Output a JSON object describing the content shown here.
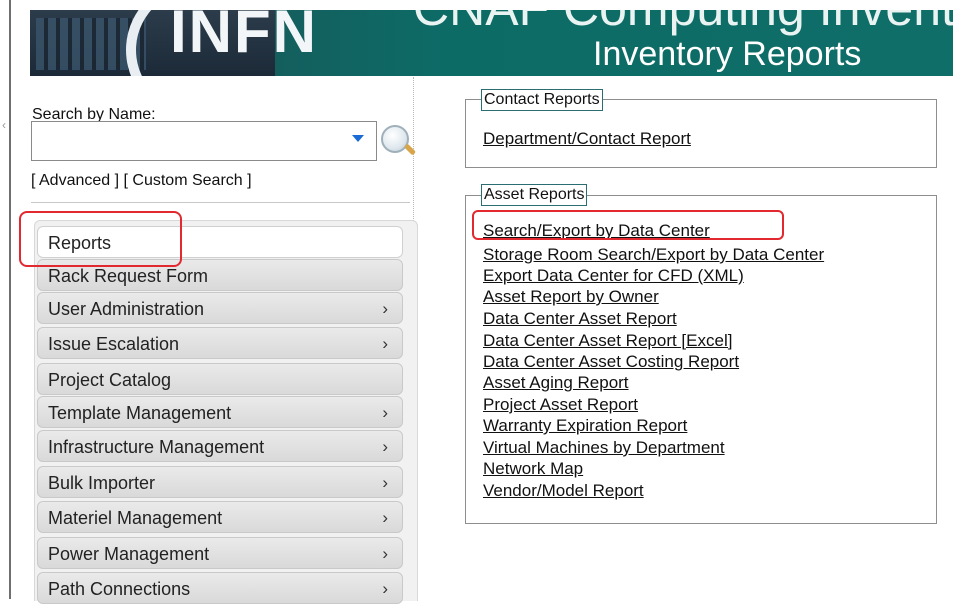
{
  "header": {
    "logo_text": "INFN",
    "title": "CNAF Computing Inventory",
    "subtitle": "Inventory Reports",
    "colors": {
      "banner": "#0f6e68",
      "logo_bg": "#1c2a38"
    }
  },
  "sidebar": {
    "search_label": "Search by Name:",
    "search_value": "",
    "advanced_link": "[ Advanced ]",
    "custom_search_link": "[ Custom Search ]",
    "menu": [
      {
        "label": "Reports",
        "submenu": false,
        "active": true
      },
      {
        "label": "Rack Request Form",
        "submenu": false
      },
      {
        "label": "User Administration",
        "submenu": true
      },
      {
        "label": "Issue Escalation",
        "submenu": true
      },
      {
        "label": "Project Catalog",
        "submenu": false
      },
      {
        "label": "Template Management",
        "submenu": true
      },
      {
        "label": "Infrastructure Management",
        "submenu": true
      },
      {
        "label": "Bulk Importer",
        "submenu": true
      },
      {
        "label": "Materiel Management",
        "submenu": true
      },
      {
        "label": "Power Management",
        "submenu": true
      },
      {
        "label": "Path Connections",
        "submenu": true
      }
    ],
    "chevron": "›"
  },
  "main": {
    "contact_reports": {
      "legend": "Contact Reports",
      "links": [
        "Department/Contact Report"
      ]
    },
    "asset_reports": {
      "legend": "Asset Reports",
      "links": [
        "Search/Export by Data Center",
        "Storage Room Search/Export by Data Center",
        "Export Data Center for CFD (XML)",
        "Asset Report by Owner",
        "Data Center Asset Report",
        "Data Center Asset Report [Excel]",
        "Data Center Asset Costing Report",
        "Asset Aging Report",
        "Project Asset Report",
        "Warranty Expiration Report",
        "Virtual Machines by Department",
        "Network Map",
        "Vendor/Model Report"
      ]
    }
  },
  "highlight_color": "#e2292f"
}
